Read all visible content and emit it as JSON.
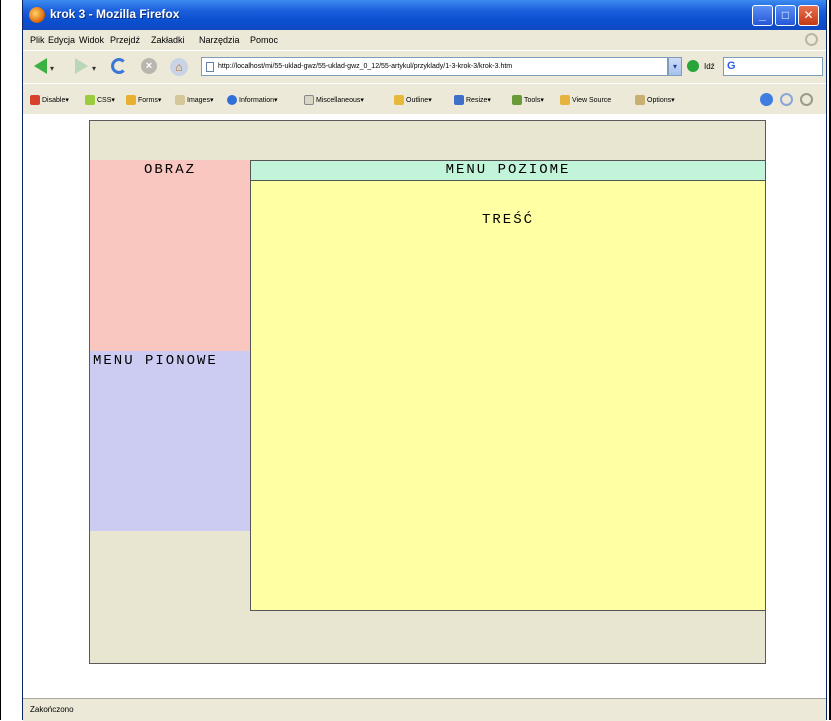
{
  "window": {
    "title": "krok 3 - Mozilla Firefox"
  },
  "menubar": [
    "Plik",
    "Edycja",
    "Widok",
    "Przejdź",
    "Zakładki",
    "Narzędzia",
    "Pomoc"
  ],
  "navbar": {
    "url": "http://localhost/mi/55-uklad-gwz/55-uklad-gwz_0_12/55-artykul/przyklady/1-3-krok-3/krok-3.htm",
    "go_label": "Idź"
  },
  "devbar": {
    "items": [
      "Disable",
      "CSS",
      "Forms",
      "Images",
      "Information",
      "Miscellaneous",
      "Outline",
      "Resize",
      "Tools",
      "View Source",
      "Options"
    ]
  },
  "page": {
    "obraz": "OBRAZ",
    "menu_pionowe": "MENU PIONOWE",
    "menu_poziome": "MENU POZIOME",
    "tresc": "TREŚĆ"
  },
  "status": {
    "text": "Zakończono"
  },
  "colors": {
    "obraz": "#f9c6c0",
    "menu_pionowe": "#ccccf2",
    "menu_poziome": "#c2f4d9",
    "tresc": "#ffffa3",
    "container": "#e8e6d0"
  }
}
